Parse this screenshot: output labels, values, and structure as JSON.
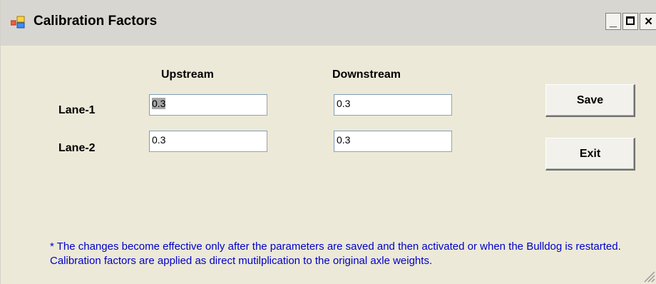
{
  "window": {
    "title": "Calibration Factors",
    "controls": {
      "minimize": "_",
      "close": "×"
    }
  },
  "columns": {
    "upstream": "Upstream",
    "downstream": "Downstream"
  },
  "rows": [
    {
      "label": "Lane-1",
      "upstream": "0.3",
      "downstream": "0.3"
    },
    {
      "label": "Lane-2",
      "upstream": "0.3",
      "downstream": "0.3"
    }
  ],
  "buttons": {
    "save": "Save",
    "exit": "Exit"
  },
  "note": "* The changes become effective only after the parameters are saved and then activated or when the Bulldog is restarted. Calibration factors are applied as direct mutilplication to the original axle weights.",
  "colors": {
    "note_text": "#0000c8",
    "window_bg": "#ece9d8"
  }
}
